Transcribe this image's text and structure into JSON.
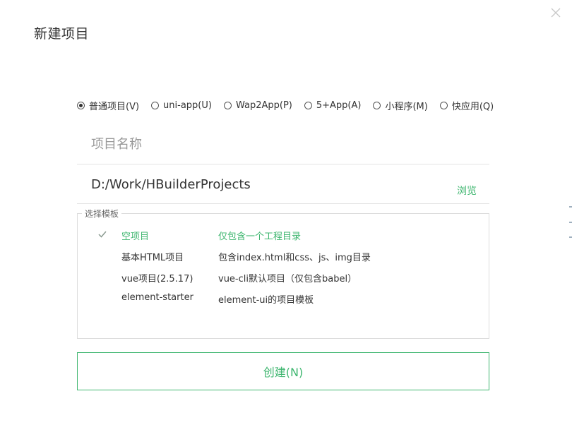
{
  "dialog": {
    "title": "新建项目",
    "close_icon": "close-icon"
  },
  "project_types": [
    {
      "label": "普通项目(V)",
      "selected": true
    },
    {
      "label": "uni-app(U)",
      "selected": false
    },
    {
      "label": "Wap2App(P)",
      "selected": false
    },
    {
      "label": "5+App(A)",
      "selected": false
    },
    {
      "label": "小程序(M)",
      "selected": false
    },
    {
      "label": "快应用(Q)",
      "selected": false
    }
  ],
  "project_name": {
    "value": "",
    "placeholder": "项目名称"
  },
  "location": {
    "value": "D:/Work/HBuilderProjects",
    "browse_label": "浏览"
  },
  "templates": {
    "legend": "选择模板",
    "items": [
      {
        "name": "空项目",
        "desc": "仅包含一个工程目录",
        "selected": true
      },
      {
        "name": "基本HTML项目",
        "desc": "包含index.html和css、js、img目录",
        "selected": false
      },
      {
        "name": "vue项目(2.5.17)",
        "desc": "vue-cli默认项目（仅包含babel）",
        "selected": false
      },
      {
        "name": "element-starter",
        "desc": "element-ui的项目模板",
        "selected": false
      }
    ]
  },
  "actions": {
    "create_label": "创建(N)"
  },
  "colors": {
    "accent": "#3eb66f",
    "text": "#333333",
    "muted": "#999999",
    "border": "#dcdcdc"
  }
}
